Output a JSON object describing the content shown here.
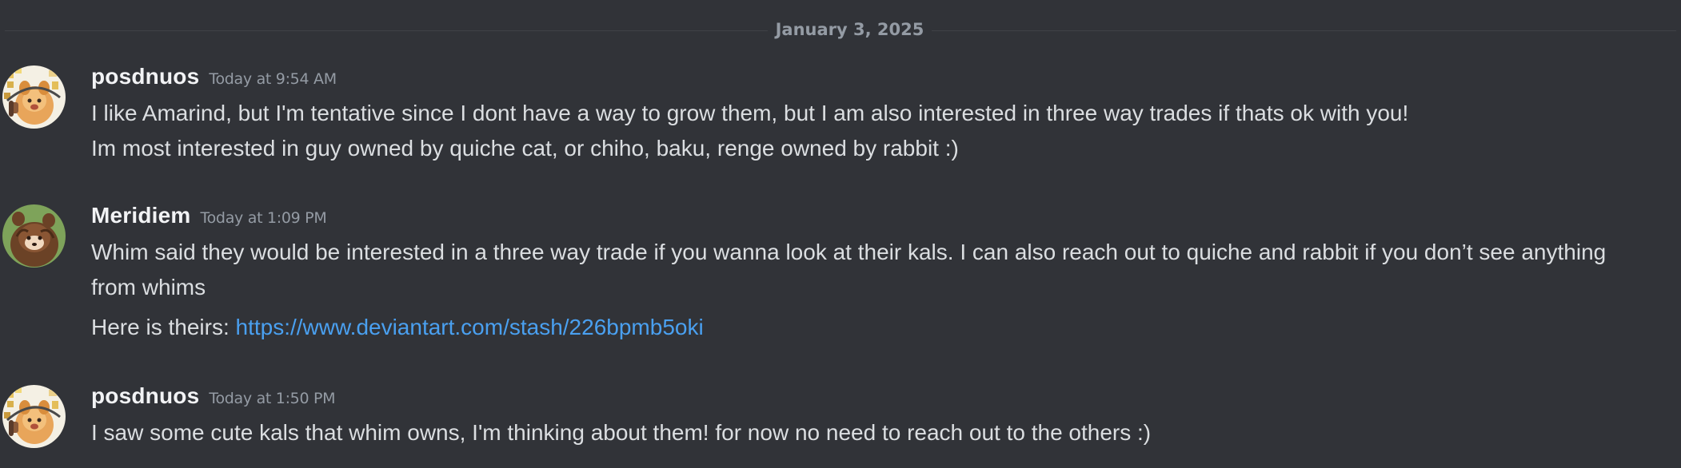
{
  "divider": {
    "date": "January 3, 2025"
  },
  "messages": [
    {
      "username": "posdnuos",
      "timestamp": "Today at 9:54 AM",
      "avatar_icon": "user-avatar",
      "lines": [
        "I like Amarind, but I'm tentative since I dont have a way to grow them, but I am also interested in three way trades if thats ok with you!",
        "Im most interested in guy owned by quiche cat,  or chiho, baku, renge owned by rabbit :)"
      ]
    },
    {
      "username": "Meridiem",
      "timestamp": "Today at 1:09 PM",
      "avatar_icon": "user-avatar",
      "lines": [
        "Whim said they would be interested in a three way trade if you wanna look at their kals. I can also reach out to quiche and rabbit if you don’t see anything from whims"
      ],
      "link_line": {
        "prefix": "Here is theirs: ",
        "url": "https://www.deviantart.com/stash/226bpmb5oki"
      }
    },
    {
      "username": "posdnuos",
      "timestamp": "Today at 1:50 PM",
      "avatar_icon": "user-avatar",
      "lines": [
        "I saw some cute kals that whim owns, I'm thinking about them! for now no need to reach out to the others :)"
      ]
    }
  ],
  "colors": {
    "background": "#313338",
    "text": "#dbdee1",
    "username": "#f2f3f5",
    "muted": "#949ba4",
    "link": "#4aa0f0"
  }
}
